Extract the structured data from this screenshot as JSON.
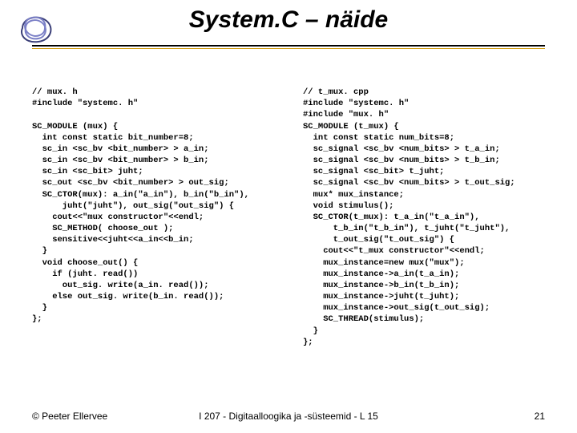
{
  "title": "System.C – näide",
  "code_left": "// mux. h\n#include \"systemc. h\"\n\nSC_MODULE (mux) {\n  int const static bit_number=8;\n  sc_in <sc_bv <bit_number> > a_in;\n  sc_in <sc_bv <bit_number> > b_in;\n  sc_in <sc_bit> juht;\n  sc_out <sc_bv <bit_number> > out_sig;\n  SC_CTOR(mux): a_in(\"a_in\"), b_in(\"b_in\"),\n      juht(\"juht\"), out_sig(\"out_sig\") {\n    cout<<\"mux constructor\"<<endl;\n    SC_METHOD( choose_out );\n    sensitive<<juht<<a_in<<b_in;\n  }\n  void choose_out() {\n    if (juht. read())\n      out_sig. write(a_in. read());\n    else out_sig. write(b_in. read());\n  }\n};",
  "code_right": "// t_mux. cpp\n#include \"systemc. h\"\n#include \"mux. h\"\nSC_MODULE (t_mux) {\n  int const static num_bits=8;\n  sc_signal <sc_bv <num_bits> > t_a_in;\n  sc_signal <sc_bv <num_bits> > t_b_in;\n  sc_signal <sc_bit> t_juht;\n  sc_signal <sc_bv <num_bits> > t_out_sig;\n  mux* mux_instance;\n  void stimulus();\n  SC_CTOR(t_mux): t_a_in(\"t_a_in\"),\n      t_b_in(\"t_b_in\"), t_juht(\"t_juht\"),\n      t_out_sig(\"t_out_sig\") {\n    cout<<\"t_mux constructor\"<<endl;\n    mux_instance=new mux(\"mux\");\n    mux_instance->a_in(t_a_in);\n    mux_instance->b_in(t_b_in);\n    mux_instance->juht(t_juht);\n    mux_instance->out_sig(t_out_sig);\n    SC_THREAD(stimulus);\n  }\n};",
  "footer": {
    "left": "© Peeter Ellervee",
    "center": "I 207 - Digitaalloogika ja -süsteemid - L 15",
    "right": "21"
  },
  "colors": {
    "accent": "#7a5c1a",
    "logo_dark": "#3b3f78",
    "logo_mid": "#7a7fc6"
  }
}
